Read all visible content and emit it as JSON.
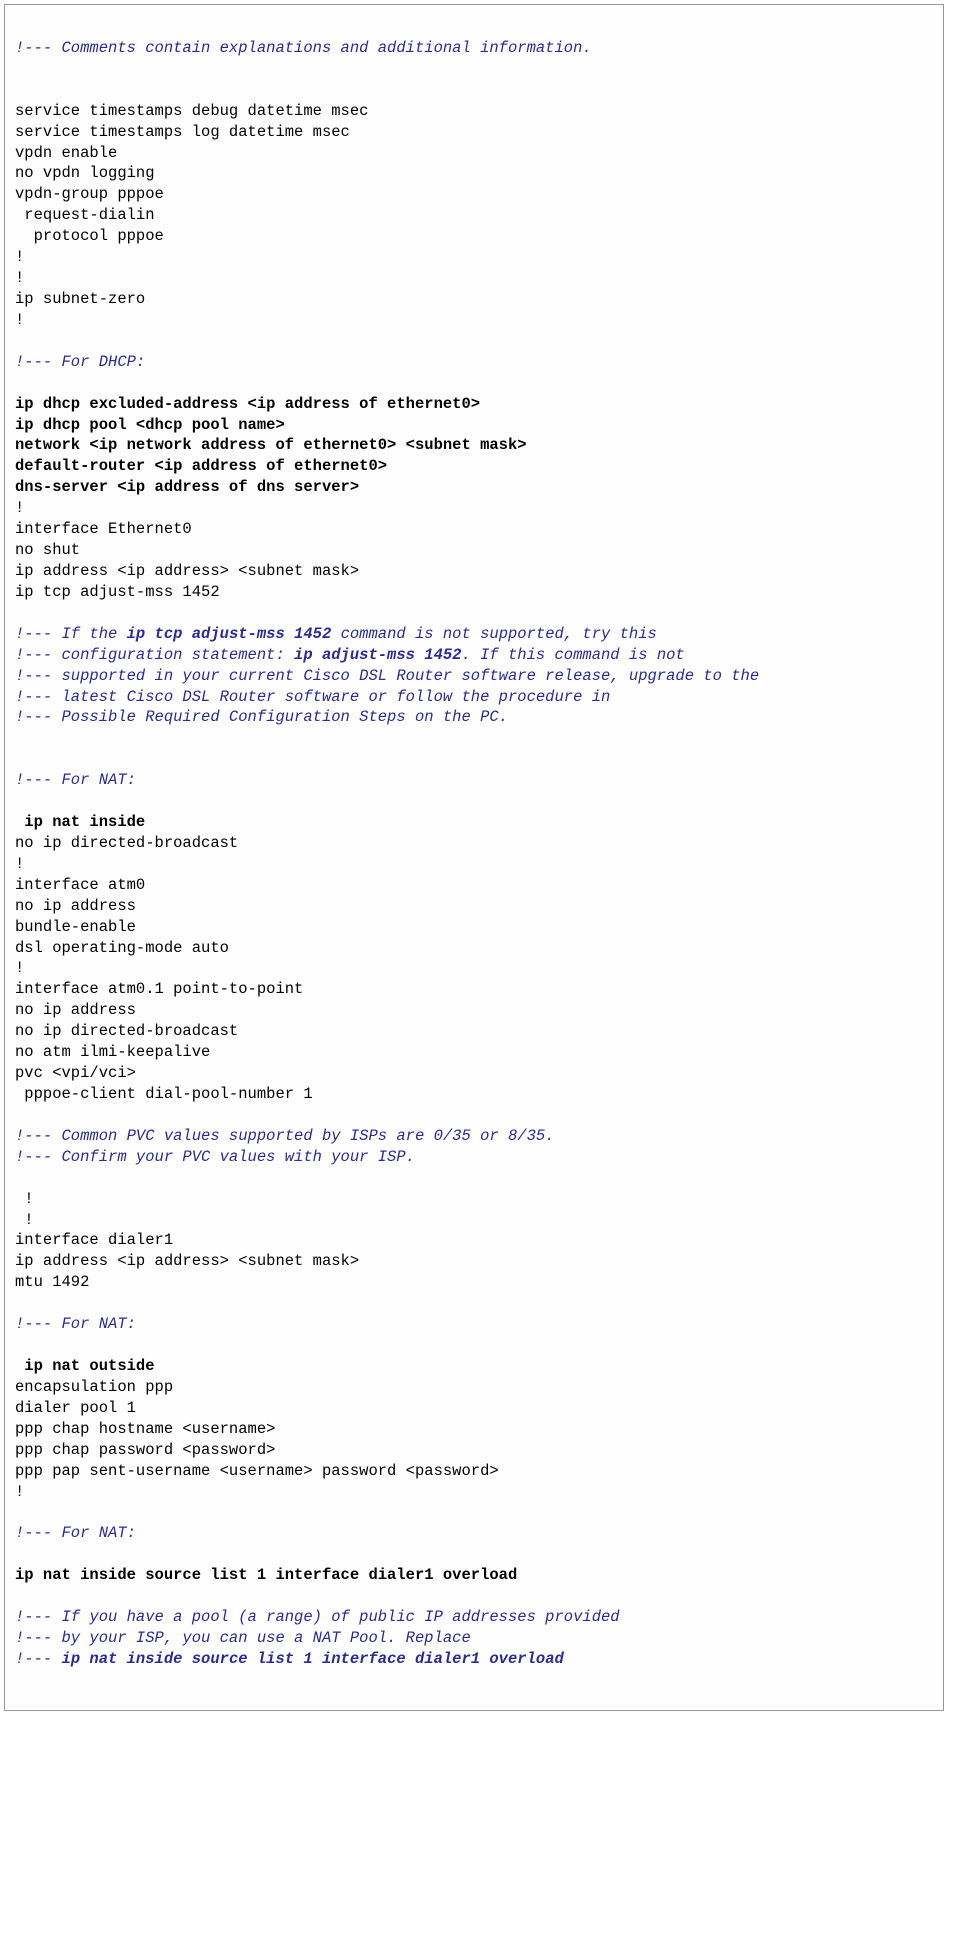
{
  "lines": [
    {
      "segs": [
        {
          "t": "",
          "cls": "p"
        }
      ]
    },
    {
      "segs": [
        {
          "t": "!--- Comments contain explanations and additional information.",
          "cls": "c"
        }
      ]
    },
    {
      "segs": [
        {
          "t": "",
          "cls": "p"
        }
      ]
    },
    {
      "segs": [
        {
          "t": "",
          "cls": "p"
        }
      ]
    },
    {
      "segs": [
        {
          "t": "service timestamps debug datetime msec",
          "cls": "p"
        }
      ]
    },
    {
      "segs": [
        {
          "t": "service timestamps log datetime msec",
          "cls": "p"
        }
      ]
    },
    {
      "segs": [
        {
          "t": "vpdn enable",
          "cls": "p"
        }
      ]
    },
    {
      "segs": [
        {
          "t": "no vpdn logging",
          "cls": "p"
        }
      ]
    },
    {
      "segs": [
        {
          "t": "vpdn-group pppoe",
          "cls": "p"
        }
      ]
    },
    {
      "segs": [
        {
          "t": " request-dialin",
          "cls": "p"
        }
      ]
    },
    {
      "segs": [
        {
          "t": "  protocol pppoe",
          "cls": "p"
        }
      ]
    },
    {
      "segs": [
        {
          "t": "!",
          "cls": "p"
        }
      ]
    },
    {
      "segs": [
        {
          "t": "!",
          "cls": "p"
        }
      ]
    },
    {
      "segs": [
        {
          "t": "ip subnet-zero",
          "cls": "p"
        }
      ]
    },
    {
      "segs": [
        {
          "t": "!",
          "cls": "p"
        }
      ]
    },
    {
      "segs": [
        {
          "t": "",
          "cls": "p"
        }
      ]
    },
    {
      "segs": [
        {
          "t": "!--- For DHCP:",
          "cls": "c"
        }
      ]
    },
    {
      "segs": [
        {
          "t": "",
          "cls": "p"
        }
      ]
    },
    {
      "segs": [
        {
          "t": "ip dhcp excluded-address <ip address of ethernet0>",
          "cls": "b"
        }
      ]
    },
    {
      "segs": [
        {
          "t": "ip dhcp pool <dhcp pool name>",
          "cls": "b"
        }
      ]
    },
    {
      "segs": [
        {
          "t": "network <ip network address of ethernet0> <subnet mask>",
          "cls": "b"
        }
      ]
    },
    {
      "segs": [
        {
          "t": "default-router <ip address of ethernet0>",
          "cls": "b"
        }
      ]
    },
    {
      "segs": [
        {
          "t": "dns-server <ip address of dns server>",
          "cls": "b"
        }
      ]
    },
    {
      "segs": [
        {
          "t": "!",
          "cls": "p"
        }
      ]
    },
    {
      "segs": [
        {
          "t": "interface Ethernet0",
          "cls": "p"
        }
      ]
    },
    {
      "segs": [
        {
          "t": "no shut",
          "cls": "p"
        }
      ]
    },
    {
      "segs": [
        {
          "t": "ip address <ip address> <subnet mask>",
          "cls": "p"
        }
      ]
    },
    {
      "segs": [
        {
          "t": "ip tcp adjust-mss 1452",
          "cls": "p"
        }
      ]
    },
    {
      "segs": [
        {
          "t": "",
          "cls": "p"
        }
      ]
    },
    {
      "segs": [
        {
          "t": "!--- If the ",
          "cls": "c"
        },
        {
          "t": "ip tcp adjust-mss 1452",
          "cls": "cb"
        },
        {
          "t": " command is not supported, try this",
          "cls": "c"
        }
      ]
    },
    {
      "segs": [
        {
          "t": "!--- configuration statement: ",
          "cls": "c"
        },
        {
          "t": "ip adjust-mss 1452",
          "cls": "cb"
        },
        {
          "t": ". If this command is not",
          "cls": "c"
        }
      ]
    },
    {
      "segs": [
        {
          "t": "!--- supported in your current Cisco DSL Router software release, upgrade to the",
          "cls": "c"
        }
      ]
    },
    {
      "segs": [
        {
          "t": "!--- latest Cisco DSL Router software or follow the procedure in",
          "cls": "c"
        }
      ]
    },
    {
      "segs": [
        {
          "t": "!--- Possible Required Configuration Steps on the PC.",
          "cls": "c"
        }
      ]
    },
    {
      "segs": [
        {
          "t": "",
          "cls": "p"
        }
      ]
    },
    {
      "segs": [
        {
          "t": "",
          "cls": "p"
        }
      ]
    },
    {
      "segs": [
        {
          "t": "!--- For NAT:",
          "cls": "c"
        }
      ]
    },
    {
      "segs": [
        {
          "t": "",
          "cls": "p"
        }
      ]
    },
    {
      "segs": [
        {
          "t": " ip nat inside",
          "cls": "b"
        }
      ]
    },
    {
      "segs": [
        {
          "t": "no ip directed-broadcast",
          "cls": "p"
        }
      ]
    },
    {
      "segs": [
        {
          "t": "!",
          "cls": "p"
        }
      ]
    },
    {
      "segs": [
        {
          "t": "interface atm0",
          "cls": "p"
        }
      ]
    },
    {
      "segs": [
        {
          "t": "no ip address",
          "cls": "p"
        }
      ]
    },
    {
      "segs": [
        {
          "t": "bundle-enable",
          "cls": "p"
        }
      ]
    },
    {
      "segs": [
        {
          "t": "dsl operating-mode auto",
          "cls": "p"
        }
      ]
    },
    {
      "segs": [
        {
          "t": "!",
          "cls": "p"
        }
      ]
    },
    {
      "segs": [
        {
          "t": "interface atm0.1 point-to-point",
          "cls": "p"
        }
      ]
    },
    {
      "segs": [
        {
          "t": "no ip address",
          "cls": "p"
        }
      ]
    },
    {
      "segs": [
        {
          "t": "no ip directed-broadcast",
          "cls": "p"
        }
      ]
    },
    {
      "segs": [
        {
          "t": "no atm ilmi-keepalive",
          "cls": "p"
        }
      ]
    },
    {
      "segs": [
        {
          "t": "pvc <vpi/vci>",
          "cls": "p"
        }
      ]
    },
    {
      "segs": [
        {
          "t": " pppoe-client dial-pool-number 1",
          "cls": "p"
        }
      ]
    },
    {
      "segs": [
        {
          "t": "",
          "cls": "p"
        }
      ]
    },
    {
      "segs": [
        {
          "t": "!--- Common PVC values supported by ISPs are 0/35 or 8/35.",
          "cls": "c"
        }
      ]
    },
    {
      "segs": [
        {
          "t": "!--- Confirm your PVC values with your ISP.",
          "cls": "c"
        }
      ]
    },
    {
      "segs": [
        {
          "t": "",
          "cls": "p"
        }
      ]
    },
    {
      "segs": [
        {
          "t": " !",
          "cls": "p"
        }
      ]
    },
    {
      "segs": [
        {
          "t": " !",
          "cls": "p"
        }
      ]
    },
    {
      "segs": [
        {
          "t": "interface dialer1",
          "cls": "p"
        }
      ]
    },
    {
      "segs": [
        {
          "t": "ip address <ip address> <subnet mask>",
          "cls": "p"
        }
      ]
    },
    {
      "segs": [
        {
          "t": "mtu 1492",
          "cls": "p"
        }
      ]
    },
    {
      "segs": [
        {
          "t": "",
          "cls": "p"
        }
      ]
    },
    {
      "segs": [
        {
          "t": "!--- For NAT:",
          "cls": "c"
        }
      ]
    },
    {
      "segs": [
        {
          "t": "",
          "cls": "p"
        }
      ]
    },
    {
      "segs": [
        {
          "t": " ip nat outside",
          "cls": "b"
        }
      ]
    },
    {
      "segs": [
        {
          "t": "encapsulation ppp",
          "cls": "p"
        }
      ]
    },
    {
      "segs": [
        {
          "t": "dialer pool 1",
          "cls": "p"
        }
      ]
    },
    {
      "segs": [
        {
          "t": "ppp chap hostname <username>",
          "cls": "p"
        }
      ]
    },
    {
      "segs": [
        {
          "t": "ppp chap password <password>",
          "cls": "p"
        }
      ]
    },
    {
      "segs": [
        {
          "t": "ppp pap sent-username <username> password <password>",
          "cls": "p"
        }
      ]
    },
    {
      "segs": [
        {
          "t": "!",
          "cls": "p"
        }
      ]
    },
    {
      "segs": [
        {
          "t": "",
          "cls": "p"
        }
      ]
    },
    {
      "segs": [
        {
          "t": "!--- For NAT:",
          "cls": "c"
        }
      ]
    },
    {
      "segs": [
        {
          "t": "",
          "cls": "p"
        }
      ]
    },
    {
      "segs": [
        {
          "t": "ip nat inside source list 1 interface dialer1 overload",
          "cls": "b"
        }
      ]
    },
    {
      "segs": [
        {
          "t": "",
          "cls": "p"
        }
      ]
    },
    {
      "segs": [
        {
          "t": "!--- If you have a pool (a range) of public IP addresses provided",
          "cls": "c"
        }
      ]
    },
    {
      "segs": [
        {
          "t": "!--- by your ISP, you can use a NAT Pool. Replace",
          "cls": "c"
        }
      ]
    },
    {
      "segs": [
        {
          "t": "!--- ",
          "cls": "c"
        },
        {
          "t": "ip nat inside source list 1 interface dialer1 overload",
          "cls": "cb"
        }
      ]
    }
  ]
}
